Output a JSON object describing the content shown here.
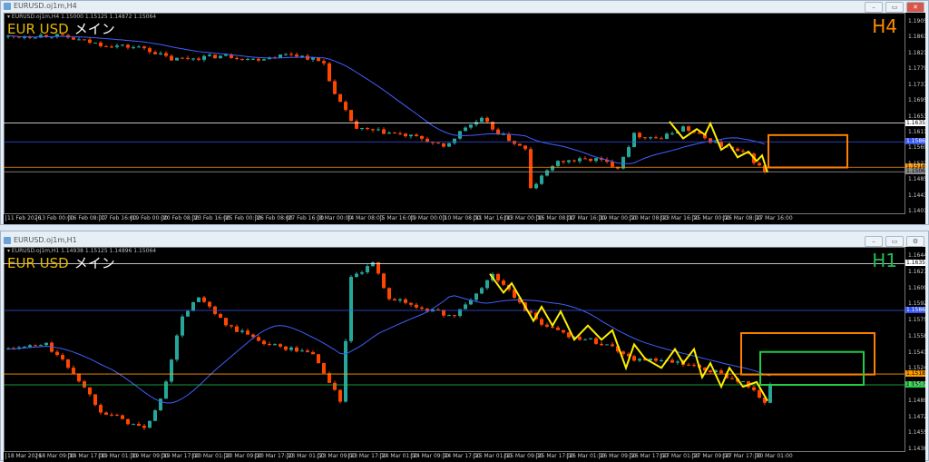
{
  "colors": {
    "bull": "#26a69a",
    "bear": "#ff4500",
    "ma": "#4060ff",
    "zigzag": "#ffee00"
  },
  "windows": [
    {
      "title": "EURUSD.oj1m,H4",
      "info": "▾ EURUSD.oj1m,H4  1.15000 1.15125 1.14872 1.15064",
      "label_a": "EUR USD",
      "label_b": "メイン",
      "tf": "H4",
      "tf_color": "#ff8c00",
      "y_range": [
        1.1401,
        1.1905
      ],
      "price_ticks": [
        "1.19050",
        "1.18630",
        "1.18210",
        "1.17790",
        "1.17370",
        "1.16950",
        "1.16530",
        "1.16110",
        "1.15690",
        "1.15270",
        "1.14850",
        "1.14430",
        "1.14010"
      ],
      "time_ticks": [
        "11 Feb 2026",
        "13 Feb 00:00",
        "16 Feb 08:00",
        "17 Feb 16:00",
        "19 Feb 00:00",
        "20 Feb 08:00",
        "23 Feb 16:00",
        "25 Feb 00:00",
        "26 Feb 08:00",
        "27 Feb 16:00",
        "3 Mar 00:00",
        "4 Mar 08:00",
        "5 Mar 16:00",
        "9 Mar 00:00",
        "10 Mar 08:00",
        "11 Mar 16:00",
        "13 Mar 00:00",
        "16 Mar 08:00",
        "17 Mar 16:00",
        "19 Mar 00:00",
        "20 Mar 08:00",
        "23 Mar 16:00",
        "25 Mar 00:00",
        "26 Mar 08:00",
        "27 Mar 16:00"
      ],
      "levels": [
        {
          "price": 1.16358,
          "text": "1.16358",
          "color": "#ffffff"
        },
        {
          "price": 1.15861,
          "text": "1.15861",
          "color": "#3355ee"
        },
        {
          "price": 1.15185,
          "text": "1.15185",
          "color": "#ff9900"
        },
        {
          "price": 1.15064,
          "text": "1.15064",
          "color": "#8a8a8a"
        }
      ],
      "boxes": [
        {
          "t": [
            140,
            154.5
          ],
          "p": [
            1.1604,
            1.1518
          ],
          "color": "#ff8000"
        }
      ],
      "path": [
        [
          0,
          1.1865
        ],
        [
          8,
          1.187
        ],
        [
          17,
          1.1845
        ],
        [
          25,
          1.1835
        ],
        [
          30,
          1.1805
        ],
        [
          35,
          1.181
        ],
        [
          40,
          1.1815
        ],
        [
          45,
          1.1805
        ],
        [
          52,
          1.182
        ],
        [
          55,
          1.181
        ],
        [
          58,
          1.1795
        ],
        [
          60,
          1.171
        ],
        [
          64,
          1.162
        ],
        [
          70,
          1.161
        ],
        [
          76,
          1.1595
        ],
        [
          80,
          1.157
        ],
        [
          84,
          1.1625
        ],
        [
          87,
          1.1645
        ],
        [
          90,
          1.161
        ],
        [
          95,
          1.1565
        ],
        [
          100,
          1.1525
        ],
        [
          95.5,
          1.1455
        ],
        [
          96,
          1.146
        ],
        [
          102,
          1.1535
        ],
        [
          108,
          1.154
        ],
        [
          112,
          1.152
        ],
        [
          115,
          1.1605
        ],
        [
          120,
          1.1595
        ],
        [
          124,
          1.1625
        ],
        [
          128,
          1.1595
        ],
        [
          132,
          1.157
        ],
        [
          136,
          1.155
        ],
        [
          139,
          1.1505
        ]
      ],
      "zigzag": [
        [
          121.5,
          1.164
        ],
        [
          124,
          1.1595
        ],
        [
          126.5,
          1.162
        ],
        [
          128,
          1.1605
        ],
        [
          129,
          1.1635
        ],
        [
          131,
          1.1565
        ],
        [
          132.5,
          1.158
        ],
        [
          134,
          1.1545
        ],
        [
          136,
          1.156
        ],
        [
          137.5,
          1.1535
        ],
        [
          138.5,
          1.155
        ],
        [
          139.5,
          1.1505
        ]
      ]
    },
    {
      "title": "EURUSD.oj1m,H1",
      "info": "▾ EURUSD.oj1m,H1  1.14938 1.15125 1.14896 1.15064",
      "label_a": "EUR USD",
      "label_b": "メイン",
      "tf": "H1",
      "tf_color": "#22bb55",
      "y_range": [
        1.14385,
        1.1644
      ],
      "price_ticks": [
        "1.16440",
        "1.16270",
        "1.16095",
        "1.15925",
        "1.15755",
        "1.15585",
        "1.15410",
        "1.15240",
        "1.15070",
        "1.14895",
        "1.14725",
        "1.14555",
        "1.14385"
      ],
      "time_ticks": [
        "18 Mar 2026",
        "18 Mar 09:00",
        "18 Mar 17:00",
        "19 Mar 01:00",
        "19 Mar 09:00",
        "19 Mar 17:00",
        "20 Mar 01:00",
        "20 Mar 09:00",
        "20 Mar 17:00",
        "23 Mar 01:00",
        "23 Mar 09:00",
        "23 Mar 17:00",
        "24 Mar 01:00",
        "24 Mar 09:00",
        "24 Mar 17:00",
        "25 Mar 01:00",
        "25 Mar 09:00",
        "25 Mar 17:00",
        "26 Mar 01:00",
        "26 Mar 09:00",
        "26 Mar 17:00",
        "27 Mar 01:00",
        "27 Mar 09:00",
        "27 Mar 17:00",
        "30 Mar 01:00"
      ],
      "levels": [
        {
          "price": 1.16358,
          "text": "1.16358",
          "color": "#ffffff"
        },
        {
          "price": 1.15861,
          "text": "1.15861",
          "color": "#3355ee"
        },
        {
          "price": 1.15185,
          "text": "1.15185",
          "color": "#ff9900"
        },
        {
          "price": 1.1507,
          "text": "1.15070",
          "color": "#22cc44"
        }
      ],
      "boxes": [
        {
          "t": [
            135,
            159.5
          ],
          "p": [
            1.1562,
            1.1518
          ],
          "color": "#ff8000"
        },
        {
          "t": [
            138.5,
            157.5
          ],
          "p": [
            1.1542,
            1.1507
          ],
          "color": "#22cc44"
        }
      ],
      "path": [
        [
          0,
          1.1545
        ],
        [
          7,
          1.155
        ],
        [
          12,
          1.152
        ],
        [
          17,
          1.148
        ],
        [
          25,
          1.146
        ],
        [
          28,
          1.149
        ],
        [
          32,
          1.158
        ],
        [
          35,
          1.16
        ],
        [
          40,
          1.157
        ],
        [
          48,
          1.155
        ],
        [
          56,
          1.154
        ],
        [
          60,
          1.15
        ],
        [
          61,
          1.149
        ],
        [
          63,
          1.162
        ],
        [
          67,
          1.1635
        ],
        [
          70,
          1.16
        ],
        [
          75,
          1.159
        ],
        [
          82,
          1.158
        ],
        [
          87,
          1.161
        ],
        [
          89,
          1.1625
        ],
        [
          97,
          1.1575
        ],
        [
          103,
          1.156
        ],
        [
          110,
          1.155
        ],
        [
          115,
          1.1535
        ],
        [
          123,
          1.153
        ],
        [
          130,
          1.152
        ],
        [
          135,
          1.151
        ],
        [
          139,
          1.149
        ],
        [
          140,
          1.1506
        ]
      ],
      "zigzag": [
        [
          88.5,
          1.1625
        ],
        [
          91,
          1.1605
        ],
        [
          92.5,
          1.1615
        ],
        [
          96.5,
          1.1575
        ],
        [
          98,
          1.159
        ],
        [
          100,
          1.157
        ],
        [
          101.5,
          1.1585
        ],
        [
          104,
          1.1555
        ],
        [
          106.5,
          1.157
        ],
        [
          109,
          1.1555
        ],
        [
          111,
          1.1565
        ],
        [
          113.5,
          1.1525
        ],
        [
          115,
          1.155
        ],
        [
          117,
          1.1535
        ],
        [
          120,
          1.1525
        ],
        [
          122.5,
          1.1545
        ],
        [
          124,
          1.153
        ],
        [
          126,
          1.1545
        ],
        [
          127.5,
          1.1515
        ],
        [
          129,
          1.153
        ],
        [
          131,
          1.1505
        ],
        [
          132.5,
          1.1525
        ],
        [
          135,
          1.1505
        ],
        [
          137.5,
          1.151
        ],
        [
          139.5,
          1.149
        ]
      ]
    }
  ]
}
